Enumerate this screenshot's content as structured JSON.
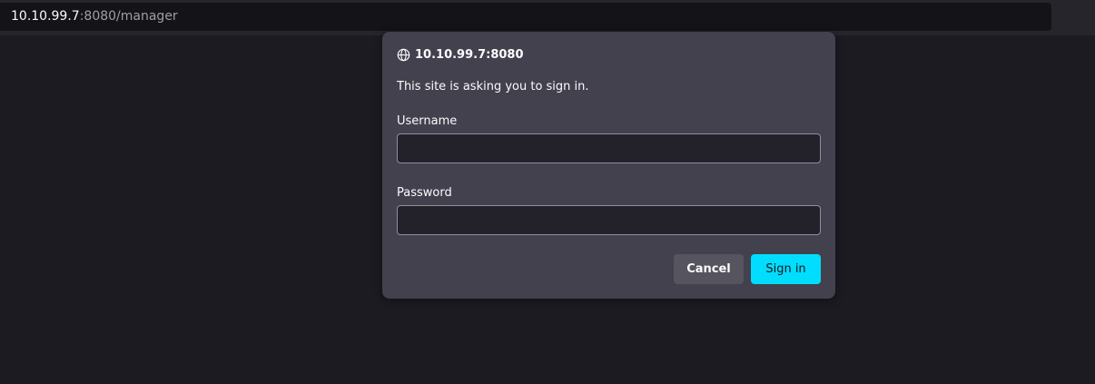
{
  "browser": {
    "url_host": "10.10.99.7",
    "url_path": ":8080/manager"
  },
  "auth_dialog": {
    "origin": "10.10.99.7:8080",
    "origin_icon": "globe-icon",
    "message": "This site is asking you to sign in.",
    "username_label": "Username",
    "username_value": "",
    "password_label": "Password",
    "password_value": "",
    "cancel_label": "Cancel",
    "signin_label": "Sign in"
  },
  "colors": {
    "page_background": "#1c1b22",
    "dialog_background": "#42414d",
    "accent": "#00ddff"
  }
}
